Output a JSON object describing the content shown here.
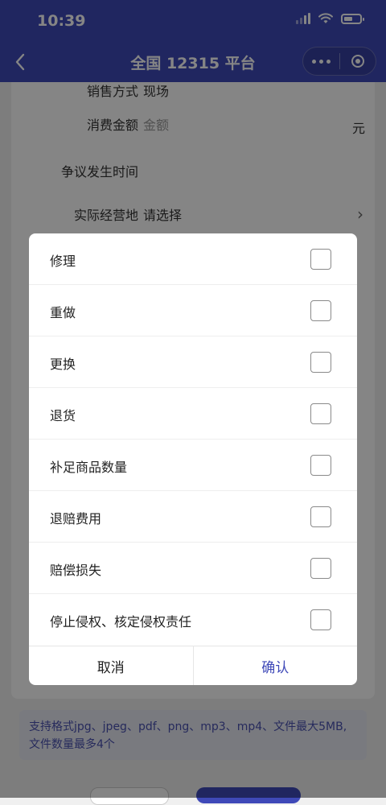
{
  "status_bar": {
    "time": "10:39"
  },
  "nav": {
    "title": "全国 12315 平台"
  },
  "form": {
    "rows": [
      {
        "label": "销售方式",
        "value": "现场"
      },
      {
        "label": "消费金额",
        "value": "金额",
        "unit": "元"
      },
      {
        "label": "争议发生时间",
        "value": ""
      },
      {
        "label": "实际经营地",
        "value": "请选择"
      }
    ],
    "hint": "支持格式jpg、jpeg、pdf、png、mp3、mp4、文件最大5MB,文件数量最多4个"
  },
  "dialog": {
    "options": [
      {
        "label": "修理"
      },
      {
        "label": "重做"
      },
      {
        "label": "更换"
      },
      {
        "label": "退货"
      },
      {
        "label": "补足商品数量"
      },
      {
        "label": "退赔费用"
      },
      {
        "label": "赔偿损失"
      },
      {
        "label": "停止侵权、核定侵权责任"
      }
    ],
    "cancel_label": "取消",
    "confirm_label": "确认"
  },
  "colors": {
    "accent": "#3f49b8",
    "hint_bg": "#e9eaf4"
  },
  "icons": [
    "back-arrow-icon",
    "more-dots-icon",
    "target-icon",
    "chevron-right-icon",
    "wifi-icon",
    "battery-icon",
    "signal-icon"
  ]
}
